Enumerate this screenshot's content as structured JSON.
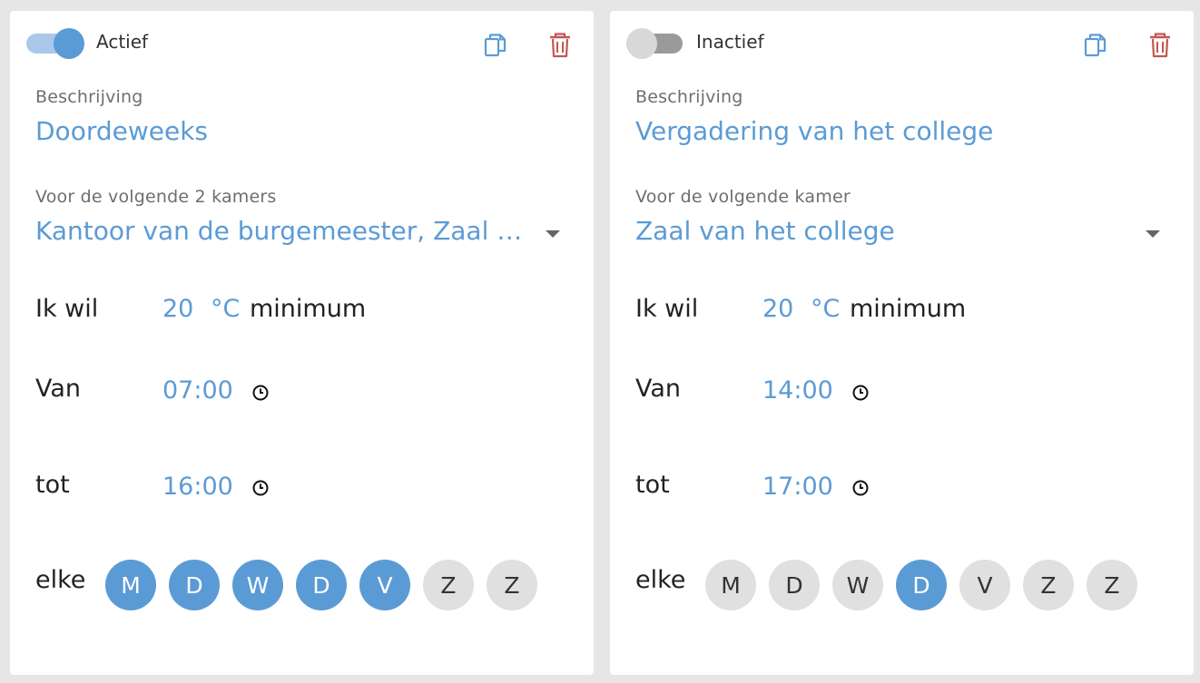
{
  "colors": {
    "accent": "#5b9bd5",
    "toggle_track_on": "#a9c8ea",
    "toggle_track_off": "#9a9a9a",
    "delete": "#c0574f",
    "day_off": "#e0e0e0"
  },
  "icons": {
    "copy": "copy-icon",
    "delete": "trash-icon",
    "clock": "clock-icon",
    "dropdown": "caret-down-icon"
  },
  "cards": [
    {
      "active": true,
      "status_label": "Actief",
      "description_label": "Beschrijving",
      "description": "Doordeweeks",
      "rooms_label": "Voor de volgende 2 kamers",
      "rooms_value": "Kantoor van de burgemeester, Zaal van het college",
      "want_label": "Ik wil",
      "temperature": "20",
      "unit": "°C",
      "mode": "minimum",
      "from_label": "Van",
      "from_time": "07:00",
      "until_label": "tot",
      "until_time": "16:00",
      "every_label": "elke",
      "days": [
        {
          "letter": "M",
          "selected": true
        },
        {
          "letter": "D",
          "selected": true
        },
        {
          "letter": "W",
          "selected": true
        },
        {
          "letter": "D",
          "selected": true
        },
        {
          "letter": "V",
          "selected": true
        },
        {
          "letter": "Z",
          "selected": false
        },
        {
          "letter": "Z",
          "selected": false
        }
      ]
    },
    {
      "active": false,
      "status_label": "Inactief",
      "description_label": "Beschrijving",
      "description": "Vergadering van het college",
      "rooms_label": "Voor de volgende kamer",
      "rooms_value": "Zaal van het college",
      "want_label": "Ik wil",
      "temperature": "20",
      "unit": "°C",
      "mode": "minimum",
      "from_label": "Van",
      "from_time": "14:00",
      "until_label": "tot",
      "until_time": "17:00",
      "every_label": "elke",
      "days": [
        {
          "letter": "M",
          "selected": false
        },
        {
          "letter": "D",
          "selected": false
        },
        {
          "letter": "W",
          "selected": false
        },
        {
          "letter": "D",
          "selected": true
        },
        {
          "letter": "V",
          "selected": false
        },
        {
          "letter": "Z",
          "selected": false
        },
        {
          "letter": "Z",
          "selected": false
        }
      ]
    }
  ]
}
